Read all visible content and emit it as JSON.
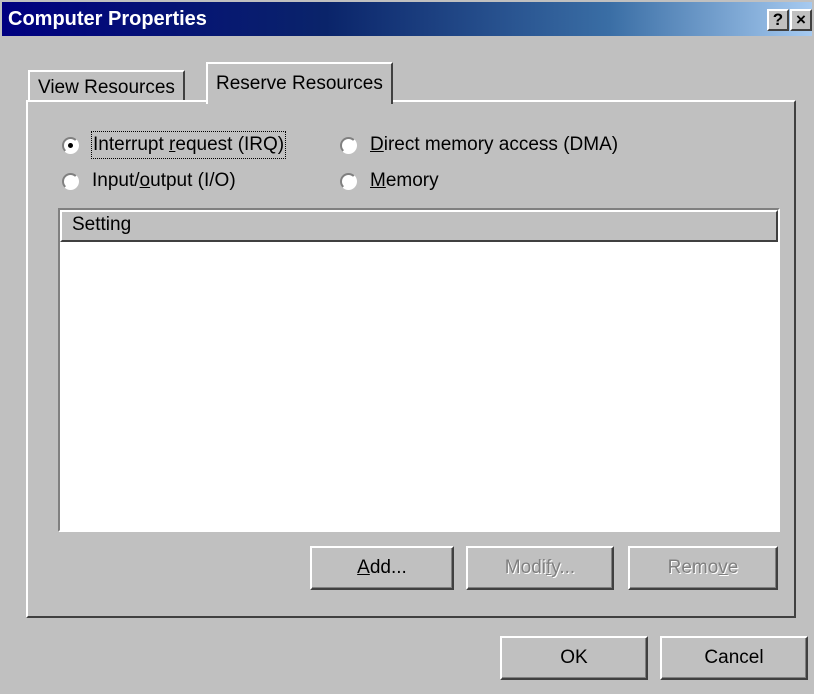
{
  "window": {
    "title": "Computer Properties",
    "help_button": "?",
    "close_button": "×"
  },
  "tabs": [
    {
      "label": "View Resources",
      "selected": false
    },
    {
      "label": "Reserve Resources",
      "selected": true
    }
  ],
  "radios": {
    "irq": {
      "before": "Interrupt ",
      "accel": "r",
      "after": "equest (IRQ)",
      "checked": true
    },
    "dma": {
      "before": "",
      "accel": "D",
      "after": "irect memory access (DMA)",
      "checked": false
    },
    "io": {
      "before": "Input/",
      "accel": "o",
      "after": "utput (I/O)",
      "checked": false
    },
    "memory": {
      "before": "",
      "accel": "M",
      "after": "emory",
      "checked": false
    }
  },
  "list": {
    "column_header": "Setting",
    "rows": []
  },
  "buttons": {
    "add": {
      "before": "",
      "accel": "A",
      "after": "dd...",
      "enabled": true
    },
    "modify": {
      "before": "Modi",
      "accel": "f",
      "after": "y...",
      "enabled": false
    },
    "remove": {
      "before": "Remo",
      "accel": "v",
      "after": "e",
      "enabled": false
    },
    "ok": "OK",
    "cancel": "Cancel"
  },
  "colors": {
    "face": "#c0c0c0",
    "title_start": "#000080",
    "title_end": "#a6caf0",
    "disabled_text": "#808080"
  }
}
